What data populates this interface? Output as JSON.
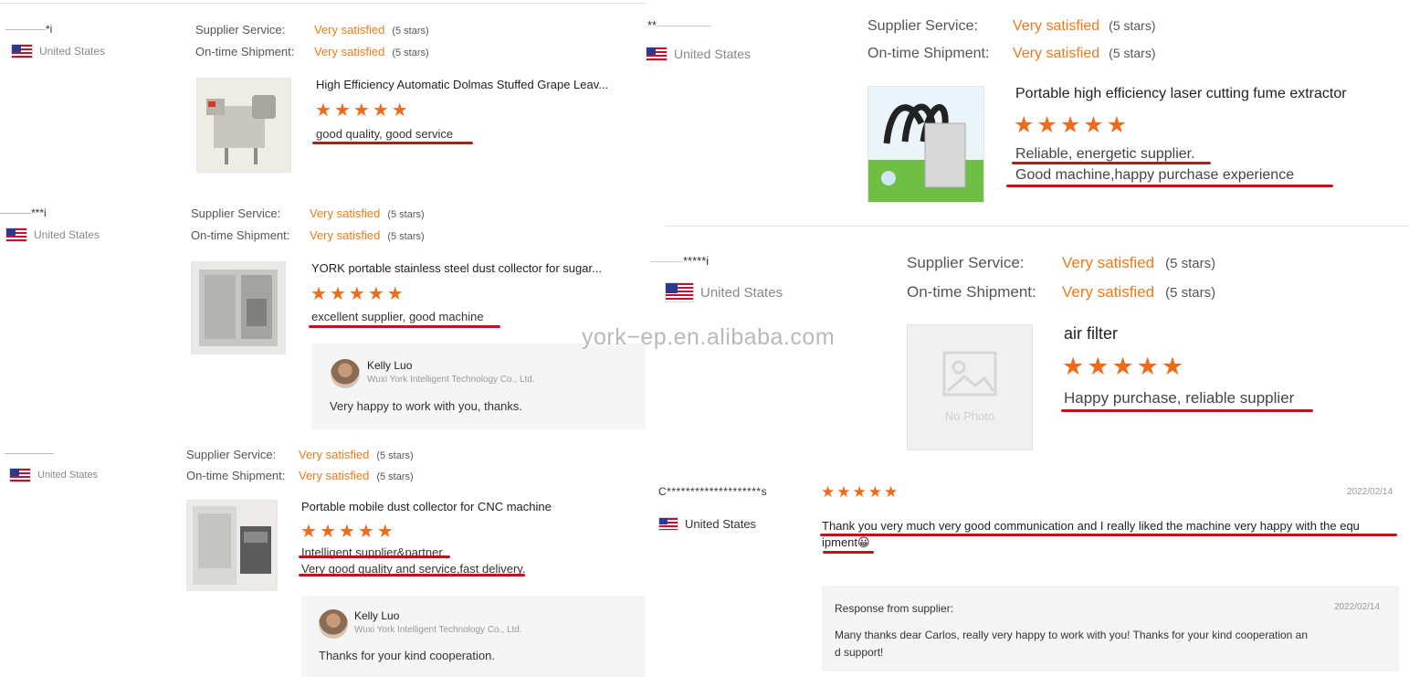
{
  "watermark": "york−ep.en.alibaba.com",
  "reviews": [
    {
      "reviewer": "*i",
      "country": "United States",
      "service_label": "Supplier Service:",
      "service_value": "Very satisfied",
      "service_count": "(5 stars)",
      "shipment_label": "On-time Shipment:",
      "shipment_value": "Very satisfied",
      "shipment_count": "(5 stars)",
      "product": "High Efficiency Automatic Dolmas Stuffed Grape Leav...",
      "stars": 5,
      "comments": [
        "good quality, good service"
      ]
    },
    {
      "reviewer": "***i",
      "country": "United States",
      "service_label": "Supplier Service:",
      "service_value": "Very satisfied",
      "service_count": "(5 stars)",
      "shipment_label": "On-time Shipment:",
      "shipment_value": "Very satisfied",
      "shipment_count": "(5 stars)",
      "product": "YORK portable stainless steel dust collector for sugar...",
      "stars": 5,
      "comments": [
        "excellent supplier, good machine"
      ],
      "reply": {
        "name": "Kelly Luo",
        "company": "Wuxi York Intelligent Technology Co., Ltd.",
        "text": "Very happy to work with you, thanks."
      }
    },
    {
      "reviewer": "",
      "country": "United States",
      "service_label": "Supplier Service:",
      "service_value": "Very satisfied",
      "service_count": "(5 stars)",
      "shipment_label": "On-time Shipment:",
      "shipment_value": "Very satisfied",
      "shipment_count": "(5 stars)",
      "product": "Portable mobile dust collector for CNC machine",
      "stars": 5,
      "comments": [
        "Intelligent supplier&partner.",
        "Very good quality and service,fast delivery."
      ],
      "reply": {
        "name": "Kelly Luo",
        "company": "Wuxi York Intelligent Technology Co., Ltd.",
        "text": "Thanks for your kind cooperation."
      }
    },
    {
      "reviewer": "**",
      "country": "United States",
      "service_label": "Supplier Service:",
      "service_value": "Very satisfied",
      "service_count": "(5 stars)",
      "shipment_label": "On-time Shipment:",
      "shipment_value": "Very satisfied",
      "shipment_count": "(5 stars)",
      "product": "Portable high efficiency laser cutting fume extractor",
      "stars": 5,
      "comments": [
        "Reliable, energetic supplier.",
        "Good machine,happy purchase experience"
      ]
    },
    {
      "reviewer": "*****i",
      "country": "United States",
      "service_label": "Supplier Service:",
      "service_value": "Very satisfied",
      "service_count": "(5 stars)",
      "shipment_label": "On-time Shipment:",
      "shipment_value": "Very satisfied",
      "shipment_count": "(5 stars)",
      "product": "air filter",
      "no_photo": "No Photo",
      "stars": 5,
      "comments": [
        "Happy purchase, reliable supplier"
      ]
    },
    {
      "reviewer": "C********************s",
      "country": "United States",
      "stars": 5,
      "date": "2022/02/14",
      "comment_line1": "Thank you very much very good communication and I really liked the machine very happy with the equ",
      "comment_line2": "ipment",
      "emoji": "😀",
      "response": {
        "label": "Response from supplier:",
        "date": "2022/02/14",
        "line1": "Many thanks dear Carlos, really very happy to work with you! Thanks for your kind cooperation an",
        "line2": "d support!"
      }
    }
  ]
}
